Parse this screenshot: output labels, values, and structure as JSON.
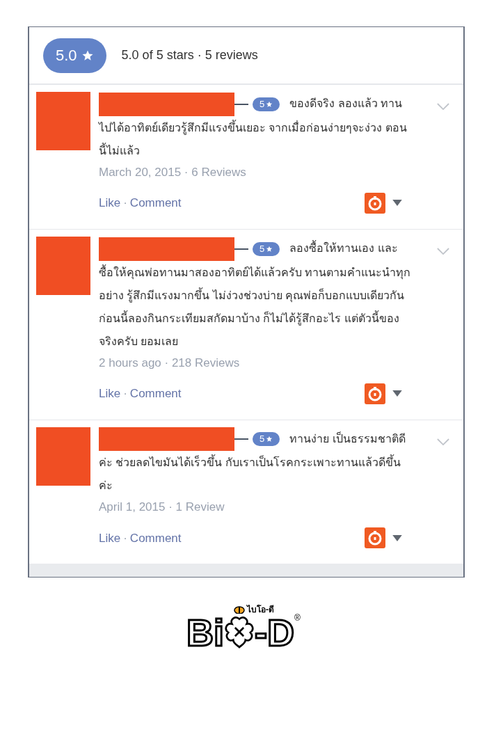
{
  "summary": {
    "rating": "5.0",
    "text": "5.0 of 5 stars · 5 reviews"
  },
  "reviews": [
    {
      "rating": "5",
      "text": "ของดีจริง ลองแล้ว ทานไปได้อาทิตย์เดียวรู้สึกมีแรงขึ้นเยอะ จากเมื่อก่อนง่ายๆจะง่วง ตอนนี้ไม่แล้ว",
      "meta": "March 20, 2015 · 6 Reviews",
      "actions": {
        "like": "Like",
        "separator": "·",
        "comment": "Comment"
      }
    },
    {
      "rating": "5",
      "text": "ลองซื้อให้ทานเอง และซื้อให้คุณพ่อทานมาสองอาทิตย์ได้แล้วครับ ทานตามคำแนะนำทุกอย่าง รู้สึกมีแรงมากขึ้น ไม่ง่วงช่วงบ่าย คุณพ่อก็บอกแบบเดียวกัน ก่อนนี้ลองกินกระเทียมสกัดมาบ้าง ก็ไม่ได้รู้สึกอะไร แต่ตัวนี้ของจริงครับ ยอมเลย",
      "meta": "2 hours ago · 218 Reviews",
      "actions": {
        "like": "Like",
        "separator": "·",
        "comment": "Comment"
      }
    },
    {
      "rating": "5",
      "text": "ทานง่าย เป็นธรรมชาติดีค่ะ ช่วยลดไขมันได้เร็วขึ้น กับเราเป็นโรคกระเพาะทานแล้วดีขึ้นค่ะ",
      "meta": "April 1, 2015 · 1 Review",
      "actions": {
        "like": "Like",
        "separator": "·",
        "comment": "Comment"
      }
    }
  ],
  "logo": {
    "thai": "ไบโอ-ดี",
    "left": "Bi",
    "right": "-D",
    "mark": "®"
  }
}
